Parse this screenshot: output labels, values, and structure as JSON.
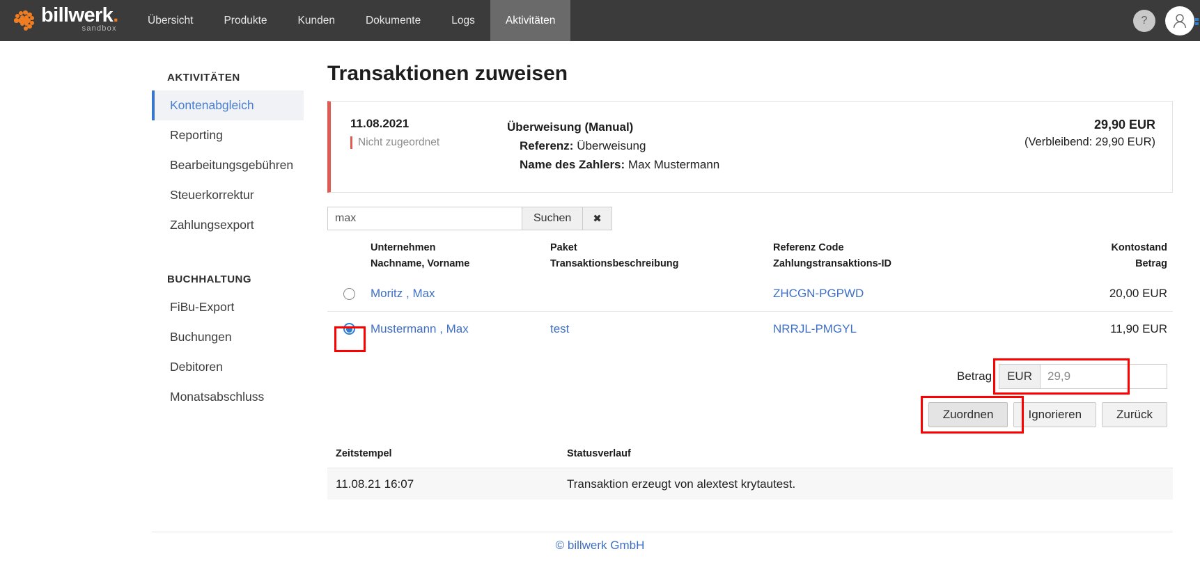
{
  "topnav": {
    "brand": {
      "word": "billwerk",
      "dot": ".",
      "sub": "sandbox"
    },
    "items": [
      {
        "label": "Übersicht",
        "active": false
      },
      {
        "label": "Produkte",
        "active": false
      },
      {
        "label": "Kunden",
        "active": false
      },
      {
        "label": "Dokumente",
        "active": false
      },
      {
        "label": "Logs",
        "active": false
      },
      {
        "label": "Aktivitäten",
        "active": true
      }
    ],
    "help_label": "?",
    "avatar_name": "user-avatar"
  },
  "sidebar": {
    "group1_title": "AKTIVITÄTEN",
    "group1_items": [
      {
        "label": "Kontenabgleich",
        "active": true
      },
      {
        "label": "Reporting",
        "active": false
      },
      {
        "label": "Bearbeitungsgebühren",
        "active": false
      },
      {
        "label": "Steuerkorrektur",
        "active": false
      },
      {
        "label": "Zahlungsexport",
        "active": false
      }
    ],
    "group2_title": "BUCHHALTUNG",
    "group2_items": [
      {
        "label": "FiBu-Export",
        "active": false
      },
      {
        "label": "Buchungen",
        "active": false
      },
      {
        "label": "Debitoren",
        "active": false
      },
      {
        "label": "Monatsabschluss",
        "active": false
      }
    ]
  },
  "main": {
    "page_title": "Transaktionen zuweisen",
    "transaction": {
      "date": "11.08.2021",
      "status": "Nicht zugeordnet",
      "type": "Überweisung (Manual)",
      "reference_label": "Referenz:",
      "reference_value": "Überweisung",
      "payer_label": "Name des Zahlers:",
      "payer_value": "Max Mustermann",
      "amount": "29,90 EUR",
      "remaining": "(Verbleibend: 29,90 EUR)"
    },
    "search": {
      "value": "max",
      "placeholder": "",
      "search_label": "Suchen",
      "clear_label": "✖"
    },
    "results": {
      "headers": {
        "company": "Unternehmen",
        "name": "Nachname, Vorname",
        "package": "Paket",
        "description": "Transaktionsbeschreibung",
        "ref_code": "Referenz Code",
        "payment_tx_id": "Zahlungstransaktions-ID",
        "balance": "Kontostand",
        "amount": "Betrag"
      },
      "rows": [
        {
          "selected": false,
          "name": "Moritz , Max",
          "package": "",
          "ref_code": "ZHCGN-PGPWD",
          "amount": "20,00 EUR"
        },
        {
          "selected": true,
          "name": "Mustermann , Max",
          "package": "test",
          "ref_code": "NRRJL-PMGYL",
          "amount": "11,90 EUR"
        }
      ]
    },
    "betrag": {
      "label": "Betrag",
      "currency": "EUR",
      "value": "29,9",
      "placeholder": ""
    },
    "actions": {
      "assign": "Zuordnen",
      "ignore": "Ignorieren",
      "back": "Zurück"
    },
    "history": {
      "header_timestamp": "Zeitstempel",
      "header_status": "Statusverlauf",
      "rows": [
        {
          "timestamp": "11.08.21 16:07",
          "status": "Transaktion erzeugt von alextest krytautest."
        }
      ]
    }
  },
  "footer": {
    "text": "© billwerk GmbH"
  },
  "colors": {
    "nav_bg": "#3b3b3b",
    "nav_active_bg": "#6a6a6a",
    "brand_orange": "#f07d22",
    "link_blue": "#3f6fc4",
    "sidebar_active_blue": "#3776c8",
    "card_accent_red": "#e05a52",
    "annotation_red": "#ff0000",
    "radio_blue": "#2f7fd0"
  }
}
